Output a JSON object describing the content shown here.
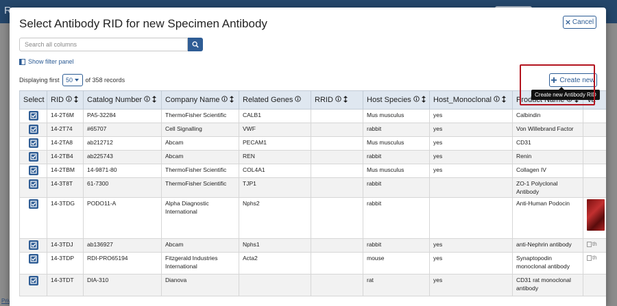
{
  "background": {
    "brand": "R",
    "footer_link": "Privacy policy"
  },
  "modal": {
    "title": "Select Antibody RID for new Specimen Antibody",
    "cancel_label": "Cancel",
    "search": {
      "placeholder": "Search all columns",
      "value": ""
    },
    "filter_link": "Show filter panel",
    "paging": {
      "prefix": "Displaying first",
      "page_size": "50",
      "suffix": "of 358 records"
    },
    "create_label": "Create new",
    "create_tooltip": "Create new Antibody RID"
  },
  "table": {
    "columns": [
      "Select",
      "RID",
      "Catalog Number",
      "Company Name",
      "Related Genes",
      "RRID",
      "Host Species",
      "Host_Monoclonal",
      "Product Name",
      "Va"
    ],
    "rows": [
      {
        "rid": "14-2T6M",
        "catalog": "PA5-32284",
        "company": "ThermoFisher Scientific",
        "genes": "CALB1",
        "rrid": "",
        "host": "Mus musculus",
        "mono": "yes",
        "product": "Calbindin",
        "img": ""
      },
      {
        "rid": "14-2T74",
        "catalog": "#65707",
        "company": "Cell Signalling",
        "genes": "VWF",
        "rrid": "",
        "host": "rabbit",
        "mono": "yes",
        "product": "Von Willebrand Factor",
        "img": ""
      },
      {
        "rid": "14-2TA8",
        "catalog": "ab212712",
        "company": "Abcam",
        "genes": "PECAM1",
        "rrid": "",
        "host": "Mus musculus",
        "mono": "yes",
        "product": "CD31",
        "img": ""
      },
      {
        "rid": "14-2TB4",
        "catalog": "ab225743",
        "company": "Abcam",
        "genes": "REN",
        "rrid": "",
        "host": "rabbit",
        "mono": "yes",
        "product": "Renin",
        "img": ""
      },
      {
        "rid": "14-2TBM",
        "catalog": "14-9871-80",
        "company": "ThermoFisher Scientific",
        "genes": "COL4A1",
        "rrid": "",
        "host": "Mus musculus",
        "mono": "yes",
        "product": "Collagen IV",
        "img": ""
      },
      {
        "rid": "14-3T8T",
        "catalog": "61-7300",
        "company": "ThermoFisher Scientific",
        "genes": "TJP1",
        "rrid": "",
        "host": "rabbit",
        "mono": "",
        "product": "ZO-1 Polyclonal Antibody",
        "img": ""
      },
      {
        "rid": "14-3TDG",
        "catalog": "PODO11-A",
        "company": "Alpha Diagnostic International",
        "genes": "Nphs2",
        "rrid": "",
        "host": "rabbit",
        "mono": "",
        "product": "Anti-Human Podocin",
        "img": "photo"
      },
      {
        "rid": "14-3TDJ",
        "catalog": "ab136927",
        "company": "Abcam",
        "genes": "Nphs1",
        "rrid": "",
        "host": "rabbit",
        "mono": "yes",
        "product": "anti-Nephrin antibody",
        "img": "broken"
      },
      {
        "rid": "14-3TDP",
        "catalog": "RDI-PRO65194",
        "company": "Fitzgerald Industries International",
        "genes": "Acta2",
        "rrid": "",
        "host": "mouse",
        "mono": "yes",
        "product": "Synaptopodin monoclonal antibody",
        "img": "broken"
      },
      {
        "rid": "14-3TDT",
        "catalog": "DIA-310",
        "company": "Dianova",
        "genes": "",
        "rrid": "",
        "host": "rat",
        "mono": "yes",
        "product": "CD31 rat monoclonal antibody",
        "img": ""
      }
    ],
    "broken_img_alt": "th"
  },
  "colors": {
    "primary": "#2f5d95",
    "header_bg": "#dfe7f0",
    "highlight": "#b3141f",
    "topbar": "#24466a"
  },
  "icons": [
    "search-icon",
    "close-icon",
    "plus-icon",
    "filter-panel-icon",
    "info-icon",
    "sort-icon",
    "checkbox-icon",
    "chevron-down-icon"
  ]
}
